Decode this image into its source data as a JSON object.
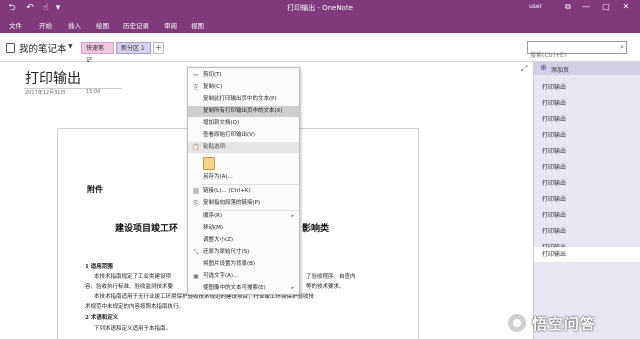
{
  "window": {
    "title": "打印输出 - OneNote",
    "user": "user",
    "controls": {
      "minimize": "—",
      "maximize": "□",
      "close": "✕"
    }
  },
  "ribbon": {
    "tabs": [
      "文件",
      "开始",
      "插入",
      "绘图",
      "历史记录",
      "审阅",
      "视图"
    ]
  },
  "notebook": {
    "name": "我的笔记本",
    "sections": [
      "快速笔记",
      "新分区 1"
    ],
    "add_section": "+"
  },
  "search": {
    "placeholder": "搜索(Ctrl+E)"
  },
  "page": {
    "title": "打印输出",
    "date": "2017年12月31日",
    "time": "15:00"
  },
  "document": {
    "heading": "附件",
    "title_left": "建设项目竣工环",
    "title_right": "影响类",
    "section1": "1 适用范围",
    "para1_line1": "本技术指南规定了工业类建设项",
    "para1_line1_right": "了验收程序、自查内",
    "para1_line2": "容、验收执行标准、验收监测技术要",
    "para1_line2_right": "等的技术要求。",
    "para2_line1": "本技术指南适用于无行业竣工环境保护验收技术规范的建设项目；行业竣工环境保护验收技",
    "para2_line2": "术规范中未规定的内容按照本指南执行。",
    "section2": "2 术语和定义",
    "para3": "下列术语和定义适用于本指南。"
  },
  "context_menu": {
    "items": [
      {
        "label": "剪切(T)",
        "icon": "✂"
      },
      {
        "label": "复制(C)",
        "icon": "⎘"
      },
      {
        "label": "复制此打印输出页中的文本(P)",
        "icon": ""
      },
      {
        "label": "复制所有打印输出页中的文本(X)",
        "icon": ""
      },
      {
        "label": "增加到文档(Q)",
        "icon": ""
      },
      {
        "label": "查看原始打印输出(V)",
        "icon": ""
      },
      {
        "label": "粘贴选项:",
        "icon": ""
      },
      {
        "label": "另存为(A)...",
        "icon": ""
      },
      {
        "label": "链接(L)...  (Ctrl+K)",
        "icon": "🔗"
      },
      {
        "label": "复制指向段落的链接(P)",
        "icon": ""
      },
      {
        "label": "顺序(R)",
        "icon": ""
      },
      {
        "label": "移动(M)",
        "icon": ""
      },
      {
        "label": "调整大小(Z)",
        "icon": ""
      },
      {
        "label": "还原为原始尺寸(S)",
        "icon": ""
      },
      {
        "label": "将图片设置为背景(B)",
        "icon": ""
      },
      {
        "label": "可选文字(A)...",
        "icon": ""
      },
      {
        "label": "使图像中的文本可搜索(E)",
        "icon": ""
      }
    ]
  },
  "page_list": {
    "add_page": "添加页",
    "items": [
      "打印输出",
      "打印输出",
      "打印输出",
      "打印输出",
      "打印输出",
      "打印输出",
      "打印输出",
      "打印输出",
      "打印输出",
      "打印输出",
      "打印输出",
      "打印输出"
    ]
  },
  "watermark": {
    "text": "悟空问答"
  },
  "colors": {
    "brand": "#80397b",
    "page_panel": "#e9e6f2",
    "highlight": "#cfcfcf"
  }
}
